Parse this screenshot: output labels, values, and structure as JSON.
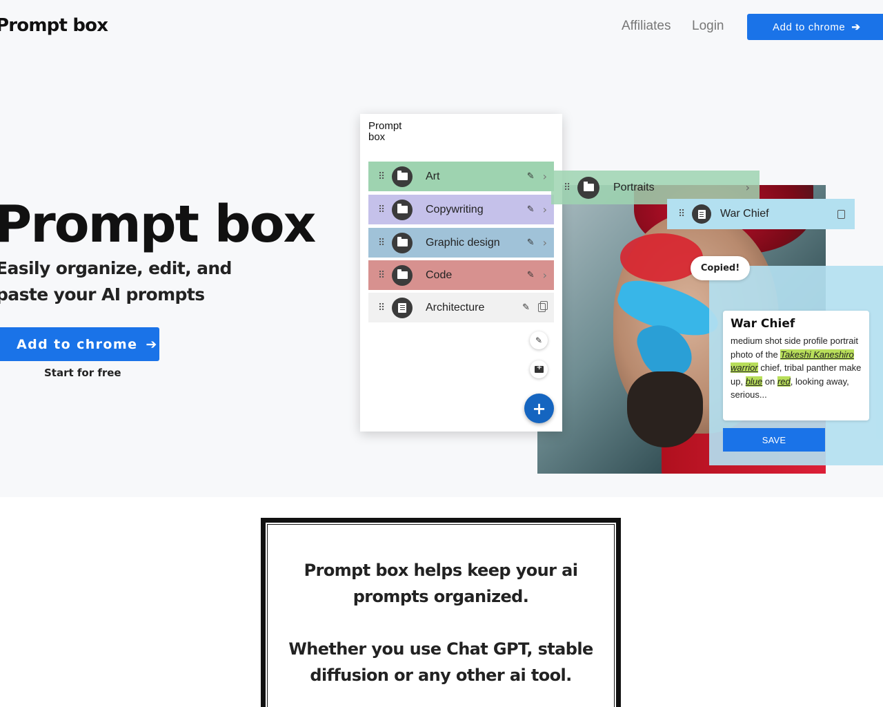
{
  "header": {
    "brand": "Prompt box",
    "nav": [
      "Affiliates",
      "Login"
    ],
    "cta_label": "Add to chrome"
  },
  "hero": {
    "title": "Prompt box",
    "subtitle": "Easily organize, edit, and paste your AI prompts",
    "cta_label": "Add to chrome",
    "cta_note": "Start for free"
  },
  "extension": {
    "title": "Prompt box",
    "items": [
      {
        "label": "Art",
        "type": "folder",
        "color": "#9ed3b0"
      },
      {
        "label": "Copywriting",
        "type": "folder",
        "color": "#c5c1ea"
      },
      {
        "label": "Graphic design",
        "type": "folder",
        "color": "#a0c2d8"
      },
      {
        "label": "Code",
        "type": "folder",
        "color": "#d7918f"
      },
      {
        "label": "Architecture",
        "type": "prompt",
        "color": "#f1f1f1"
      }
    ],
    "fab_label": "+"
  },
  "floating": {
    "folder_label": "Portraits",
    "prompt_label": "War Chief",
    "toast": "Copied!"
  },
  "prompt_card": {
    "title": "War Chief",
    "text_1": "medium shot side profile portrait photo of the ",
    "hl_1": "Takeshi Kaneshiro warrior",
    "text_2": " chief, tribal panther make up, ",
    "hl_2": "blue",
    "text_3": " on ",
    "hl_3": "red",
    "text_4": ", looking away, serious...",
    "save_label": "SAVE"
  },
  "info": {
    "line_1": "Prompt box helps keep your ai prompts organized.",
    "line_2": "Whether you use Chat GPT, stable diffusion or any other ai tool."
  },
  "colors": {
    "accent": "#1a73e8",
    "fab": "#1565c0",
    "highlight": "#b8de5a"
  }
}
